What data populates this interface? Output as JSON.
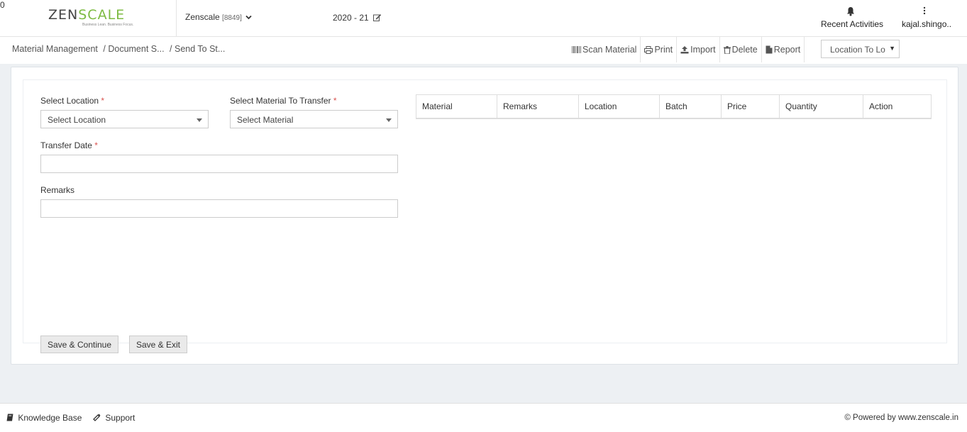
{
  "header": {
    "logo_text_left": "ZEN",
    "logo_text_mid": "SC",
    "logo_text_right": "LE",
    "logo_a": "A",
    "logo_tagline": "Business Lean. Business Focus.",
    "company_name": "Zenscale",
    "company_code": "[8849]",
    "financial_year": "2020 - 21",
    "notification_count": "0",
    "recent_activities": "Recent Activities",
    "user_name": "kajal.shingo.."
  },
  "breadcrumb": {
    "items": [
      "Material Management",
      "/ Document S...",
      "/ Send To St..."
    ]
  },
  "toolbar": {
    "scan_material": "Scan Material",
    "print": "Print",
    "import": "Import",
    "delete": "Delete",
    "report": "Report",
    "location_select": "Location To Lo"
  },
  "form": {
    "select_location_label": "Select Location",
    "select_location_value": "Select Location",
    "select_material_label": "Select Material To Transfer",
    "select_material_value": "Select Material",
    "transfer_date_label": "Transfer Date",
    "remarks_label": "Remarks",
    "required_mark": "*",
    "save_continue": "Save & Continue",
    "save_exit": "Save & Exit"
  },
  "table": {
    "columns": [
      "Material",
      "Remarks",
      "Location",
      "Batch",
      "Price",
      "Quantity",
      "Action"
    ]
  },
  "footer": {
    "knowledge_base": "Knowledge Base",
    "support": "Support",
    "powered_by": "© Powered by www.zenscale.in"
  },
  "colors": {
    "brand_green": "#7dbb42",
    "badge_red": "#d9534f",
    "content_bg": "#edf0f3"
  }
}
